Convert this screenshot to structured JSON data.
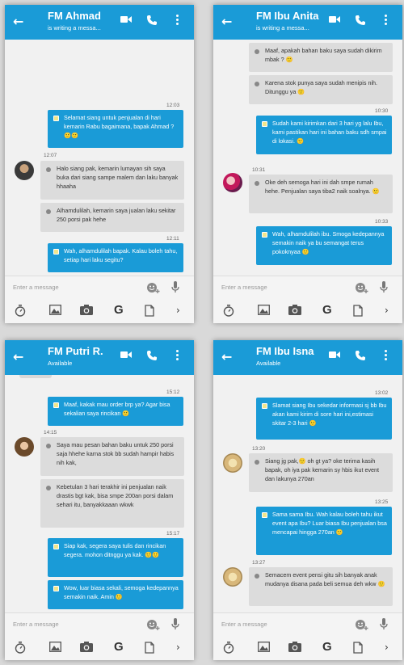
{
  "common": {
    "back_glyph": "←",
    "input_placeholder": "Enter a message",
    "next_glyph": "›",
    "g_label": "G"
  },
  "phones": [
    {
      "title": "FM Ahmad",
      "status": "is writing a messa...",
      "messages": [
        {
          "time": "12:03"
        },
        {
          "text": "Selamat siang untuk penjualan di hari kemarin Rabu bagaimana, bapak Ahmad ? 🙂🙂"
        },
        {
          "time": "12:07"
        },
        {
          "text": "Halo siang pak, kemarin lumayan sih saya buka dari siang sampe malem dan laku banyak hhaaha"
        },
        {
          "text": "Alhamdulilah, kemarin saya jualan laku sekitar 250 porsi pak hehe"
        },
        {
          "time": "12:11"
        },
        {
          "text": "Wah, alhamdulilah bapak. Kalau boleh tahu, setiap hari laku segitu?"
        }
      ]
    },
    {
      "title": "FM Ibu Anita",
      "status": "is writing a messa...",
      "messages": [
        {
          "text": "Maaf, apakah bahan baku saya sudah dikirim mbak ? 🙂"
        },
        {
          "text": "Karena stok punya saya sudah menipis nih. Ditunggu ya 🙂"
        },
        {
          "time": "10:30"
        },
        {
          "text": "Sudah kami kirimkan dari 3 hari yg lalu Ibu, kami pastikan hari ini bahan baku sdh smpai di lokasi. 🙂"
        },
        {
          "time": "10:31"
        },
        {
          "text": "Oke deh semoga hari ini dah smpe rumah hehe. Penjualan saya tiba2 naik soalnya. 🙂"
        },
        {
          "time": "10:33"
        },
        {
          "text": "Wah, alhamdulilah ibu. Smoga kedepannya semakin naik ya bu semangat terus pokoknyaa 🙂"
        }
      ]
    },
    {
      "title": "FM Putri R.",
      "status": "Available",
      "messages": [
        {
          "time": "15:12"
        },
        {
          "text": "Maaf, kakak mau order brp ya? Agar bisa sekalian saya rincikan 🙂"
        },
        {
          "time": "14:15"
        },
        {
          "text": "Saya mau pesan bahan baku untuk 250 porsi saja hhehe karna stok bb sudah hampir habis nih kak,"
        },
        {
          "text": "Kebetulan 3 hari terakhir ini penjualan naik drastis bgt kak, bisa smpe 200an porsi dalam sehari itu, banyakkaaan wkwk"
        },
        {
          "time": "15:17"
        },
        {
          "text": "Siap kak, segera saya tulis dan rincikan segera. mohon ditnggu ya kak. 🙂🙂"
        },
        {
          "text": "Wow, luar biasa sekali, semoga kedepannya semakin naik. Amin 🙂"
        }
      ]
    },
    {
      "title": "FM Ibu Isna",
      "status": "Available",
      "messages": [
        {
          "time": "13:02"
        },
        {
          "text": "Slamat siang Ibu sekedar informasi sj bb Ibu akan kami kirim di sore hari ini,estimasi skitar 2-3 hari 🙂"
        },
        {
          "time": "13:20"
        },
        {
          "text": "Siang jg pak,🙂 oh gt ya? oke terima kasih bapak, oh iya pak kemarin sy hbis ikut event dan lakunya 270an"
        },
        {
          "time": "13:25"
        },
        {
          "text": "Sama sama Ibu. Wah kalau boleh tahu ikut event apa Ibu? Luar biasa Ibu penjualan bsa mencapai hingga 270an 🙂"
        },
        {
          "time": "13:27"
        },
        {
          "text": "Semacem event pensi gitu sih banyak anak mudanya disana pada beli semua deh wkw 🙂"
        }
      ]
    }
  ]
}
